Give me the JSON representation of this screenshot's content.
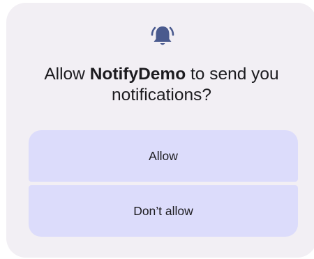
{
  "dialog": {
    "icon": "bell-ringing-icon",
    "title_prefix": "Allow ",
    "app_name": "NotifyDemo",
    "title_suffix": " to send you notifications?",
    "allow_label": "Allow",
    "deny_label": "Don’t allow"
  },
  "colors": {
    "surface": "#f2eff4",
    "button": "#dcdcfb",
    "icon": "#4a5a8e",
    "text": "#1c1b1f"
  }
}
